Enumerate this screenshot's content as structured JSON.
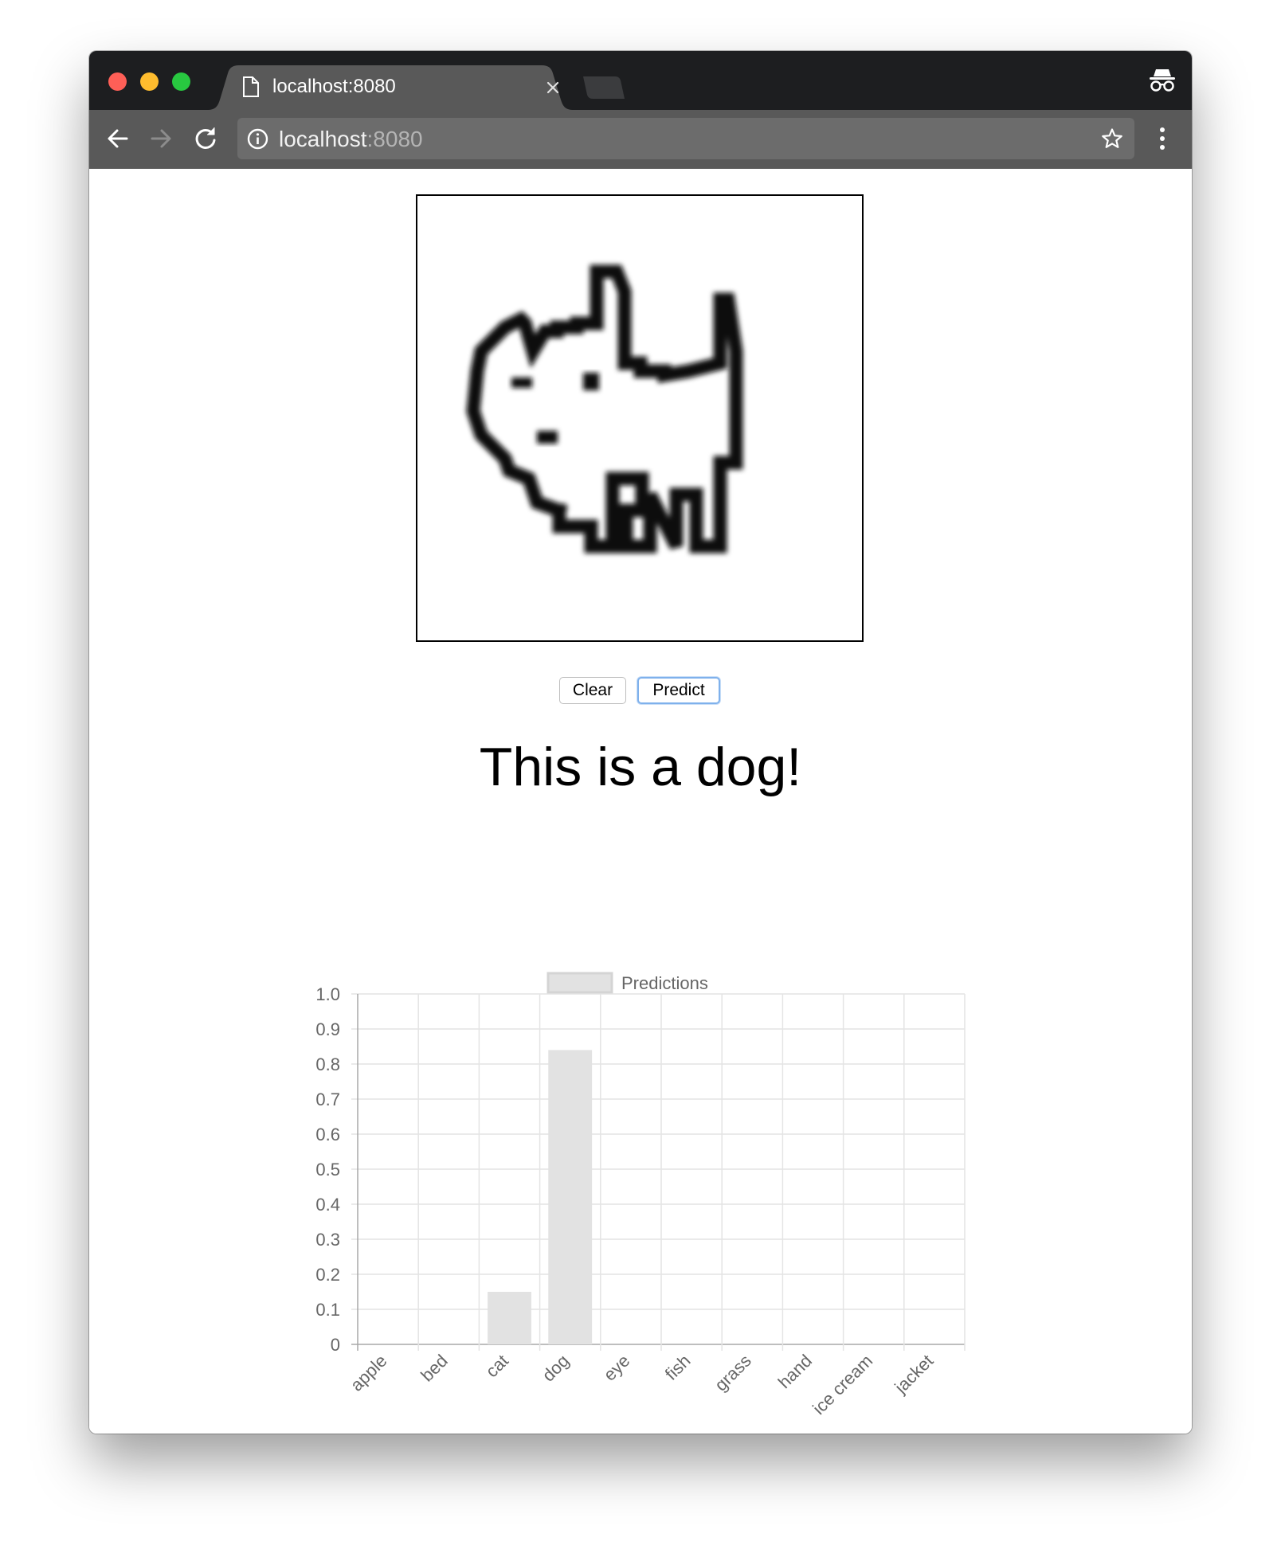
{
  "browser": {
    "tab_title": "localhost:8080",
    "url_host": "localhost",
    "url_port": ":8080"
  },
  "page": {
    "clear_label": "Clear",
    "predict_label": "Predict",
    "result_text": "This is a dog!"
  },
  "colors": {
    "bar_fill": "#e2e2e2",
    "bar_border": "#d4d4d4",
    "grid": "#e4e4e4",
    "axis_text": "#666666",
    "predict_focus": "#7fb1ec"
  },
  "chart_data": {
    "type": "bar",
    "categories": [
      "apple",
      "bed",
      "cat",
      "dog",
      "eye",
      "fish",
      "grass",
      "hand",
      "ice cream",
      "jacket"
    ],
    "series": [
      {
        "name": "Predictions",
        "values": [
          0,
          0,
          0.15,
          0.84,
          0,
          0,
          0,
          0,
          0,
          0
        ]
      }
    ],
    "ylim": [
      0,
      1.0
    ],
    "yticks": [
      "0",
      "0.1",
      "0.2",
      "0.3",
      "0.4",
      "0.5",
      "0.6",
      "0.7",
      "0.8",
      "0.9",
      "1.0"
    ],
    "legend_position": "top",
    "grid": true,
    "xlabel": "",
    "ylabel": ""
  }
}
